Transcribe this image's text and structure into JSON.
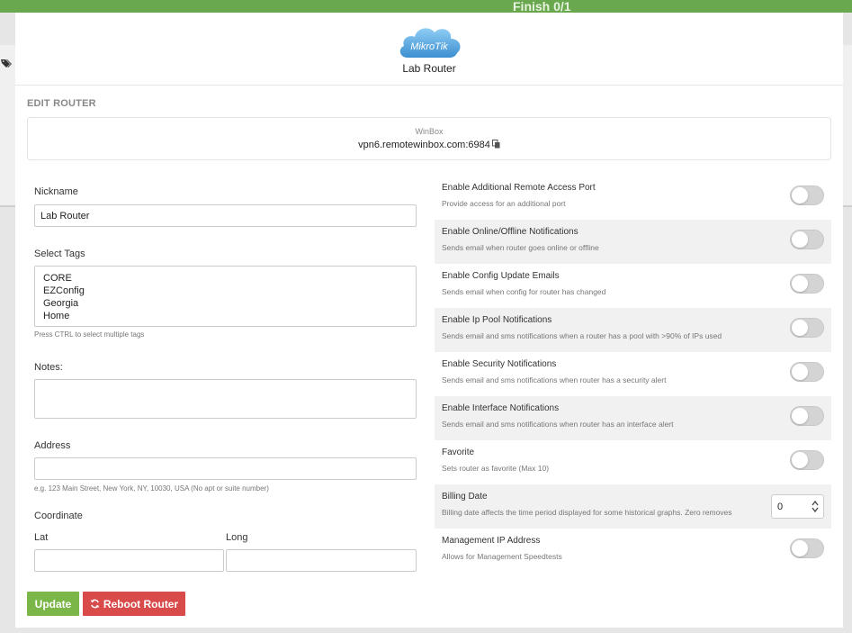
{
  "background": {
    "topbar_text": "Finish 0/1"
  },
  "header": {
    "logo_text": "MikroTik",
    "router_name": "Lab Router"
  },
  "form": {
    "section_title": "EDIT ROUTER",
    "winbox": {
      "label": "WinBox",
      "address": "vpn6.remotewinbox.com:6984"
    },
    "nickname": {
      "label": "Nickname",
      "value": "Lab Router"
    },
    "tags": {
      "label": "Select Tags",
      "options": [
        "CORE",
        "EZConfig",
        "Georgia",
        "Home"
      ],
      "hint": "Press CTRL to select multiple tags"
    },
    "notes": {
      "label": "Notes:",
      "value": ""
    },
    "address": {
      "label": "Address",
      "value": "",
      "hint": "e.g. 123 Main Street, New York, NY, 10030, USA (No apt or suite number)"
    },
    "coordinate": {
      "label": "Coordinate",
      "lat_label": "Lat",
      "long_label": "Long",
      "lat_value": "",
      "long_value": ""
    },
    "buttons": {
      "update": "Update",
      "reboot": "Reboot Router"
    }
  },
  "settings": [
    {
      "title": "Enable Additional Remote Access Port",
      "desc": "Provide access for an additional port",
      "type": "toggle",
      "enabled": false
    },
    {
      "title": "Enable Online/Offline Notifications",
      "desc": "Sends email when router goes online or offline",
      "type": "toggle",
      "enabled": false
    },
    {
      "title": "Enable Config Update Emails",
      "desc": "Sends email when config for router has changed",
      "type": "toggle",
      "enabled": false
    },
    {
      "title": "Enable Ip Pool Notifications",
      "desc": "Sends email and sms notifications when a router has a pool with >90% of IPs used",
      "type": "toggle",
      "enabled": false
    },
    {
      "title": "Enable Security Notifications",
      "desc": "Sends email and sms notifications when router has a security alert",
      "type": "toggle",
      "enabled": false
    },
    {
      "title": "Enable Interface Notifications",
      "desc": "Sends email and sms notifications when router has an interface alert",
      "type": "toggle",
      "enabled": false
    },
    {
      "title": "Favorite",
      "desc": "Sets router as favorite (Max 10)",
      "type": "toggle",
      "enabled": false
    },
    {
      "title": "Billing Date",
      "desc": "Billing date affects the time period displayed for some historical graphs. Zero removes",
      "type": "number",
      "value": "0"
    },
    {
      "title": "Management IP Address",
      "desc": "Allows for Management Speedtests",
      "type": "toggle",
      "enabled": false
    }
  ],
  "colors": {
    "topbar": "#6aa84f",
    "update_button": "#7ab648",
    "reboot_button": "#d94a4a",
    "logo_cloud": "#5aa9e0"
  }
}
